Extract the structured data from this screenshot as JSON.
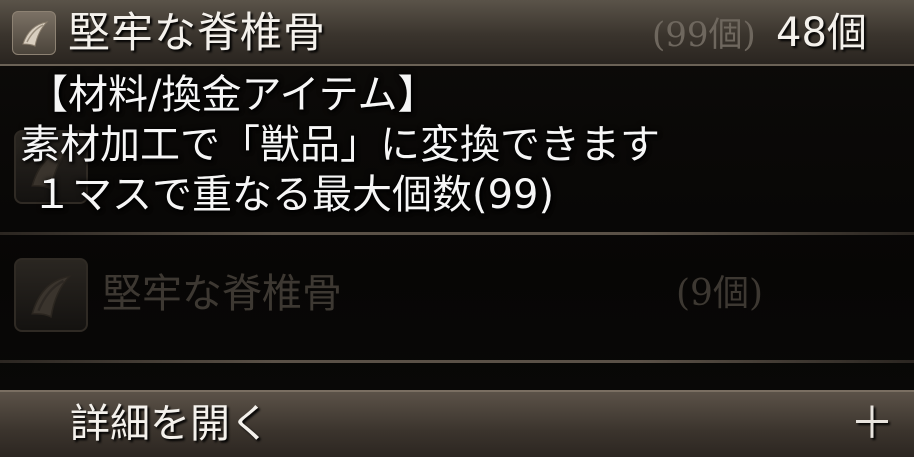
{
  "header": {
    "item_name": "堅牢な脊椎骨",
    "max_stack": "(99個)",
    "count": "48個",
    "icon": "claw-icon"
  },
  "tooltip": {
    "category": "【材料/換金アイテム】",
    "description": "素材加工で「獣品」に変換できます",
    "stack_info": "１マスで重なる最大個数(99)"
  },
  "list": [
    {
      "name": "堅牢な脊椎骨",
      "qty": "(9個)",
      "icon": "claw-icon"
    }
  ],
  "footer": {
    "label": "詳細を開く",
    "plus": "＋"
  }
}
